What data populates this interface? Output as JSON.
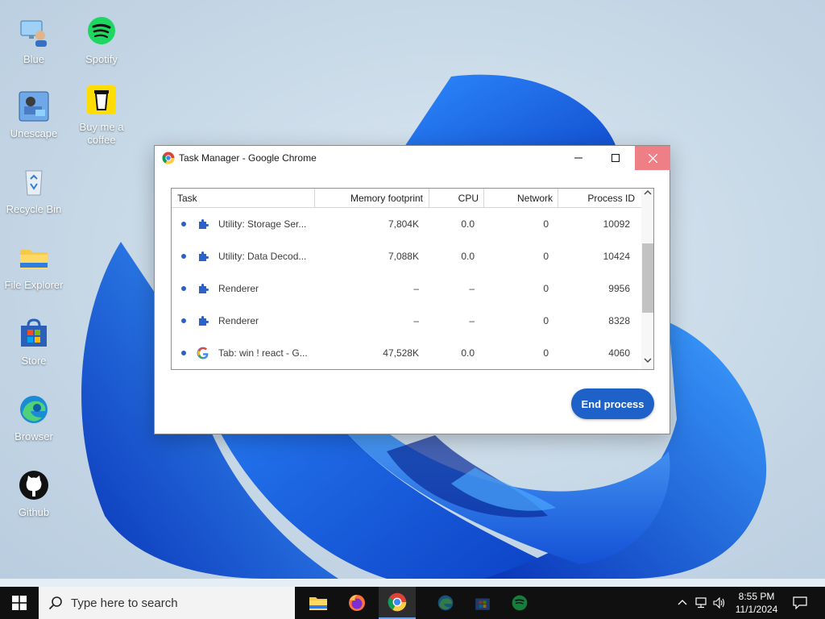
{
  "desktop": {
    "icons": [
      {
        "label": "Blue",
        "icon": "network-user-icon"
      },
      {
        "label": "Spotify",
        "icon": "spotify-icon"
      },
      {
        "label": "Unescape",
        "icon": "unescape-icon"
      },
      {
        "label": "Buy me a coffee",
        "icon": "coffee-cup-icon"
      },
      {
        "label": "Recycle Bin",
        "icon": "recycle-bin-icon"
      },
      {
        "label": "File Explorer",
        "icon": "folder-icon"
      },
      {
        "label": "Store",
        "icon": "store-icon"
      },
      {
        "label": "Browser",
        "icon": "edge-icon"
      },
      {
        "label": "Github",
        "icon": "github-icon"
      }
    ]
  },
  "window": {
    "title": "Task Manager - Google Chrome",
    "controls": {
      "minimize": "—",
      "maximize": "☐",
      "close": "✕"
    },
    "columns": [
      "Task",
      "Memory footprint",
      "CPU",
      "Network",
      "Process ID"
    ],
    "rows": [
      {
        "icon": "extension-puzzle-icon",
        "task": "Utility: Storage Ser...",
        "memory": "7,804K",
        "cpu": "0.0",
        "network": "0",
        "pid": "10092"
      },
      {
        "icon": "extension-puzzle-icon",
        "task": "Utility: Data Decod...",
        "memory": "7,088K",
        "cpu": "0.0",
        "network": "0",
        "pid": "10424"
      },
      {
        "icon": "extension-puzzle-icon",
        "task": "Renderer",
        "memory": "–",
        "cpu": "–",
        "network": "0",
        "pid": "9956"
      },
      {
        "icon": "extension-puzzle-icon",
        "task": "Renderer",
        "memory": "–",
        "cpu": "–",
        "network": "0",
        "pid": "8328"
      },
      {
        "icon": "google-g-icon",
        "task": "Tab: win ! react - G...",
        "memory": "47,528K",
        "cpu": "0.0",
        "network": "0",
        "pid": "4060"
      }
    ],
    "end_process_label": "End process"
  },
  "taskbar": {
    "search_placeholder": "Type here to search",
    "apps": [
      "file-explorer-icon",
      "firefox-icon",
      "chrome-icon",
      "edge-icon",
      "store-icon",
      "spotify-icon"
    ],
    "clock": {
      "time": "8:55 PM",
      "date": "11/1/2024"
    }
  },
  "colors": {
    "accent": "#1e61c9",
    "close_hover": "#ee7f86",
    "taskbar": "#101010"
  }
}
